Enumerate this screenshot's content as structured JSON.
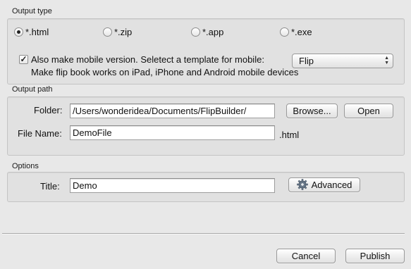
{
  "output_type": {
    "title": "Output type",
    "options": [
      {
        "label": "*.html",
        "checked": true
      },
      {
        "label": "*.zip",
        "checked": false
      },
      {
        "label": "*.app",
        "checked": false
      },
      {
        "label": "*.exe",
        "checked": false
      }
    ],
    "mobile": {
      "checked": true,
      "checkmark": "✓",
      "label": "Also make mobile version. Seletect a template for mobile:",
      "template_value": "Flip",
      "description": "Make flip book works on iPad, iPhone and Android mobile devices"
    }
  },
  "output_path": {
    "title": "Output path",
    "folder_label": "Folder:",
    "folder_value": "/Users/wonderidea/Documents/FlipBuilder/",
    "browse_label": "Browse...",
    "open_label": "Open",
    "file_name_label": "File Name:",
    "file_name_value": "DemoFile",
    "extension": ".html"
  },
  "options": {
    "title": "Options",
    "title_label": "Title:",
    "title_value": "Demo",
    "advanced_label": "Advanced",
    "advanced_icon": "gear-icon"
  },
  "footer": {
    "cancel_label": "Cancel",
    "publish_label": "Publish"
  }
}
